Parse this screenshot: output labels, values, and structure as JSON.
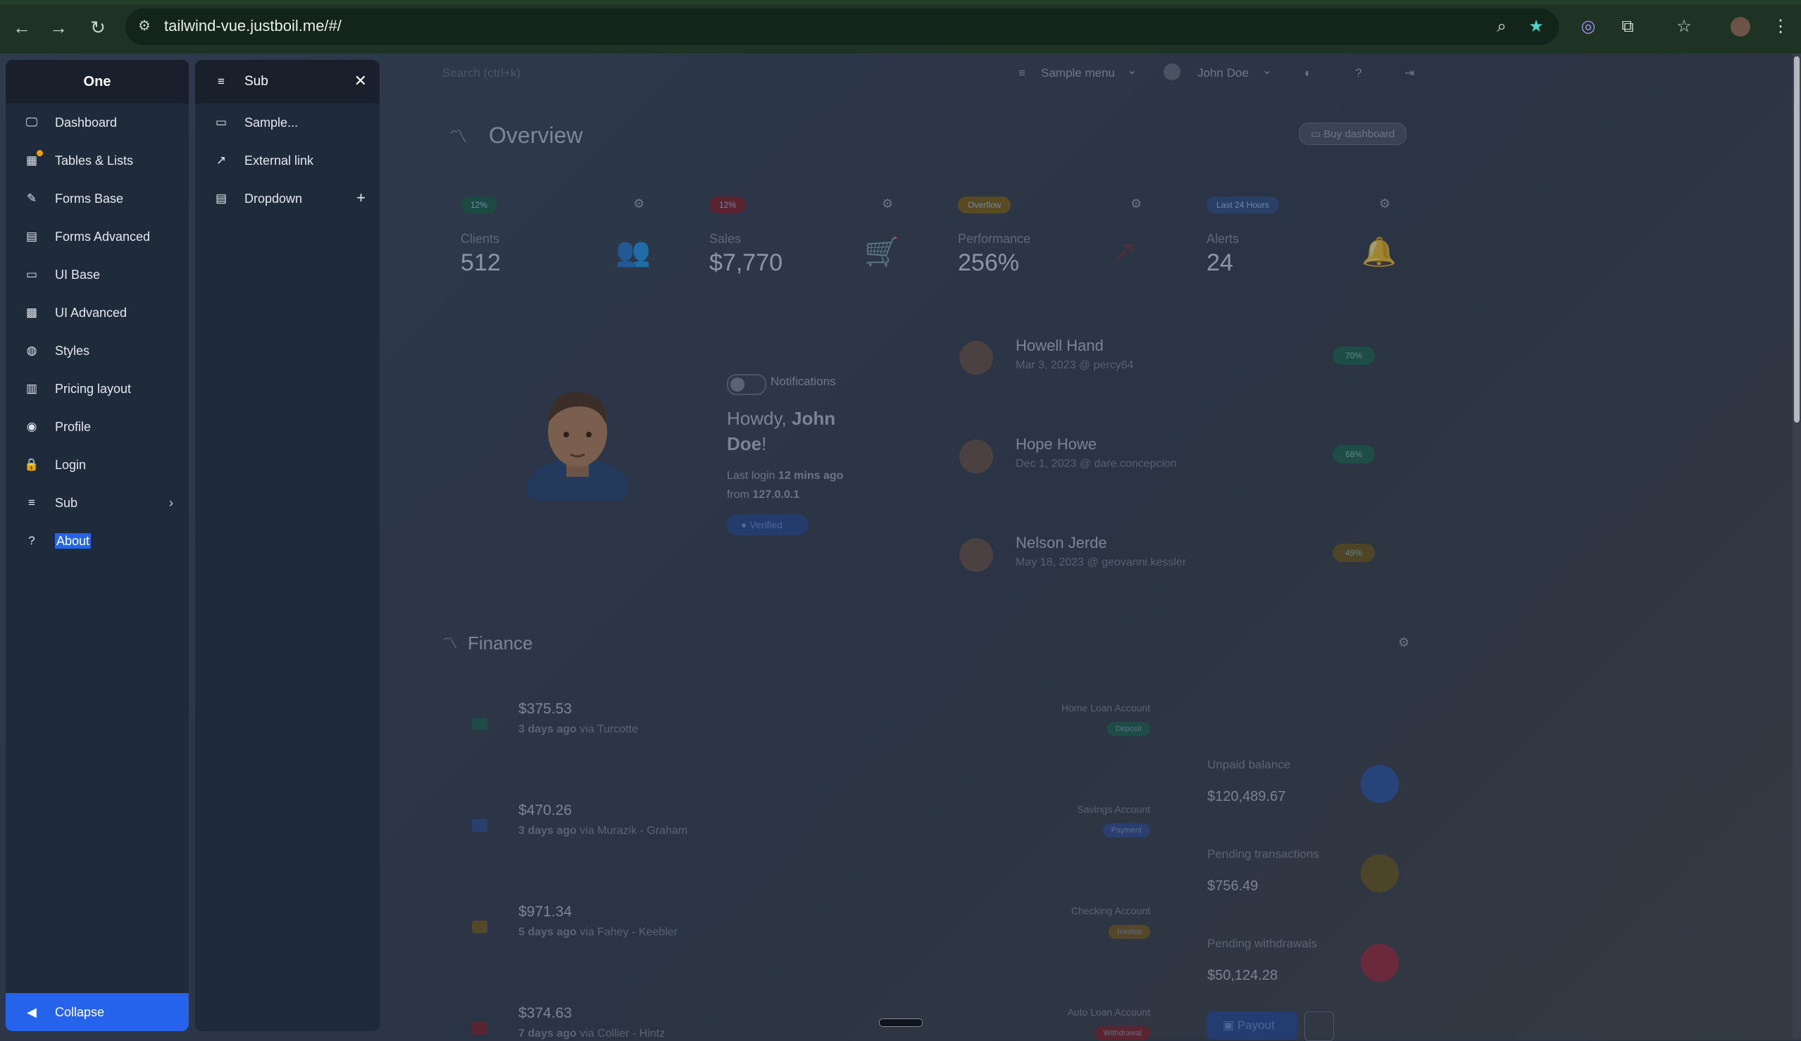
{
  "browser": {
    "url": "tailwind-vue.justboil.me/#/",
    "back_icon": "←",
    "forward_icon": "→",
    "reload_icon": "↻"
  },
  "aside_one": {
    "title": "One",
    "items": [
      {
        "label": "Dashboard",
        "icon": "monitor-icon",
        "glyph": "🖵"
      },
      {
        "label": "Tables & Lists",
        "icon": "table-icon",
        "glyph": "▦"
      },
      {
        "label": "Forms Base",
        "icon": "edit-icon",
        "glyph": "✎"
      },
      {
        "label": "Forms Advanced",
        "icon": "form-icon",
        "glyph": "▤"
      },
      {
        "label": "UI Base",
        "icon": "card-icon",
        "glyph": "▭"
      },
      {
        "label": "UI Advanced",
        "icon": "grid-icon",
        "glyph": "▩"
      },
      {
        "label": "Styles",
        "icon": "palette-icon",
        "glyph": "◍"
      },
      {
        "label": "Pricing layout",
        "icon": "pricing-icon",
        "glyph": "▥"
      },
      {
        "label": "Profile",
        "icon": "user-circle-icon",
        "glyph": "◉"
      },
      {
        "label": "Login",
        "icon": "lock-icon",
        "glyph": "🔒"
      },
      {
        "label": "Sub",
        "icon": "menu-open-icon",
        "glyph": "≡",
        "chevron": "›"
      },
      {
        "label": "About",
        "icon": "help-icon",
        "glyph": "?"
      }
    ],
    "collapse_label": "Collapse",
    "collapse_glyph": "◀"
  },
  "aside_sub": {
    "title": "Sub",
    "close_glyph": "✕",
    "items": [
      {
        "label": "Sample...",
        "glyph": "▭"
      },
      {
        "label": "External link",
        "glyph": "↗"
      },
      {
        "label": "Dropdown",
        "glyph": "▤",
        "plus": "+"
      }
    ]
  },
  "topbar": {
    "search_placeholder": "Search (ctrl+k)",
    "sample_menu": "Sample menu",
    "user": "John Doe",
    "chevron": "⌄"
  },
  "overview": {
    "title": "Overview",
    "buy_button": "Buy dashboard",
    "cards": [
      {
        "pill": "12%",
        "pill_color": "#1c4a43",
        "label": "Clients",
        "value": "512",
        "icon_color": "#1f5b4e"
      },
      {
        "pill": "12%",
        "pill_color": "#5a2430",
        "label": "Sales",
        "value": "$7,770",
        "icon_color": "#2b4e7a"
      },
      {
        "pill": "Overflow",
        "pill_color": "#5a4a24",
        "label": "Performance",
        "value": "256%",
        "icon_color": "#6b2a33"
      },
      {
        "pill": "Last 24 Hours",
        "pill_color": "#2a3f66",
        "label": "Alerts",
        "value": "24",
        "icon_color": "#5a4a21"
      }
    ]
  },
  "profile": {
    "notifications_label": "Notifications",
    "howdy_prefix": "Howdy, ",
    "name": "John Doe",
    "howdy_suffix": "!",
    "last_login_prefix": "Last login ",
    "last_login_value": "12 mins ago",
    "from_prefix": "from ",
    "ip": "127.0.0.1",
    "verified": "Verified"
  },
  "users": [
    {
      "name": "Howell Hand",
      "meta": "Mar 3, 2023 @ percy64",
      "badge": "70%",
      "badge_color": "#1d4d46"
    },
    {
      "name": "Hope Howe",
      "meta": "Dec 1, 2023 @ dare.concepcion",
      "badge": "68%",
      "badge_color": "#1d4d46"
    },
    {
      "name": "Nelson Jerde",
      "meta": "May 18, 2023 @ geovanni.kessler",
      "badge": "49%",
      "badge_color": "#4e4426"
    }
  ],
  "finance": {
    "title": "Finance",
    "transactions": [
      {
        "amount": "$375.53",
        "when": "3 days ago",
        "via": "via Turcotte",
        "account": "Home Loan Account",
        "type": "Deposit",
        "type_color": "#1d4d46"
      },
      {
        "amount": "$470.26",
        "when": "3 days ago",
        "via": "via Murazik - Graham",
        "account": "Savings Account",
        "type": "Payment",
        "type_color": "#2a3f70"
      },
      {
        "amount": "$971.34",
        "when": "5 days ago",
        "via": "via Fahey - Keebler",
        "account": "Checking Account",
        "type": "Invoice",
        "type_color": "#55482a"
      },
      {
        "amount": "$374.63",
        "when": "7 days ago",
        "via": "via Collier - Hintz",
        "account": "Auto Loan Account",
        "type": "Withdrawal",
        "type_color": "#5a2430"
      }
    ],
    "summaries": [
      {
        "label": "Unpaid balance",
        "value": "$120,489.67",
        "color": "#27447a"
      },
      {
        "label": "Pending transactions",
        "value": "$756.49",
        "color": "#4c4528"
      },
      {
        "label": "Pending withdrawals",
        "value": "$50,124.28",
        "color": "#6a2a3b"
      }
    ],
    "payout_button": "Payout"
  }
}
